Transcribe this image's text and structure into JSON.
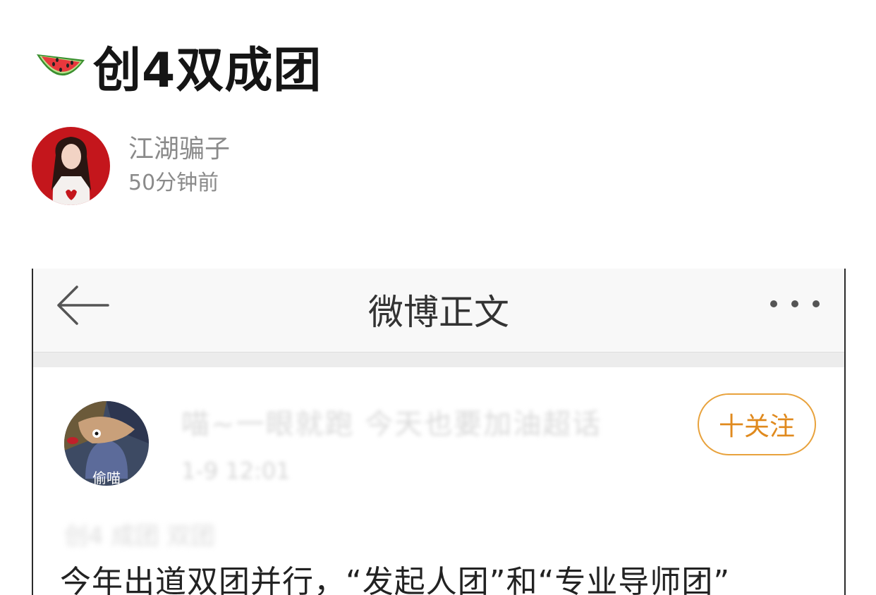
{
  "article": {
    "title_icon": "watermelon-icon",
    "title": "创4双成团"
  },
  "author": {
    "name": "江湖骗子",
    "time": "50分钟前"
  },
  "screenshot": {
    "nav": {
      "back_icon": "arrow-left-icon",
      "title": "微博正文",
      "more_icon": "more-dots-icon"
    },
    "post": {
      "avatar_caption": "偷喵",
      "username": "喵~一眼就跑 今天也要加油超话",
      "time": "1-9 12:01",
      "blurred_line": "创4 成团 双团",
      "follow_label": "十关注",
      "text": "今年出道双团并行，“发起人团”和“专业导师团”"
    }
  },
  "colors": {
    "follow_accent": "#e8a23c",
    "nav_background": "#f8f8f8",
    "secondary_text": "#8a8a8a"
  }
}
